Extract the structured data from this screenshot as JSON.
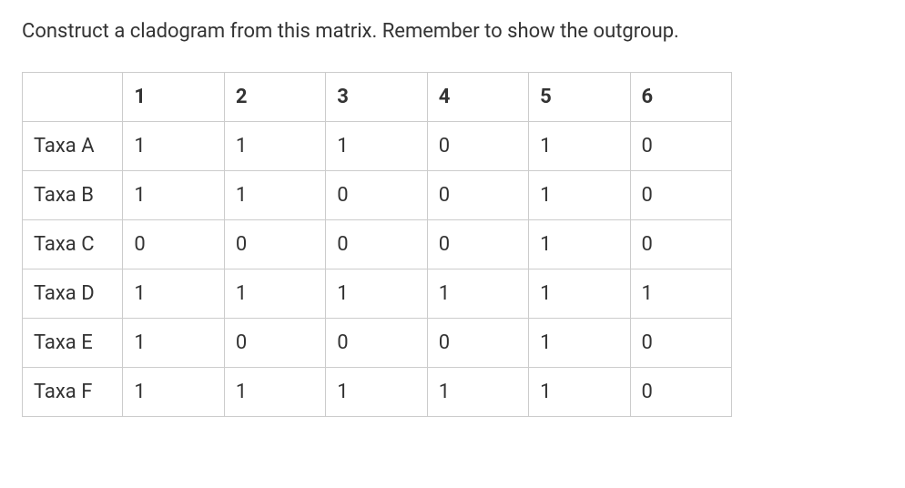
{
  "instruction": "Construct a cladogram from this matrix. Remember to show the outgroup.",
  "table": {
    "headers": [
      "",
      "1",
      "2",
      "3",
      "4",
      "5",
      "6"
    ],
    "rows": [
      {
        "label": "Taxa A",
        "values": [
          "1",
          "1",
          "1",
          "0",
          "1",
          "0"
        ]
      },
      {
        "label": "Taxa B",
        "values": [
          "1",
          "1",
          "0",
          "0",
          "1",
          "0"
        ]
      },
      {
        "label": "Taxa C",
        "values": [
          "0",
          "0",
          "0",
          "0",
          "1",
          "0"
        ]
      },
      {
        "label": "Taxa D",
        "values": [
          "1",
          "1",
          "1",
          "1",
          "1",
          "1"
        ]
      },
      {
        "label": "Taxa E",
        "values": [
          "1",
          "0",
          "0",
          "0",
          "1",
          "0"
        ]
      },
      {
        "label": "Taxa F",
        "values": [
          "1",
          "1",
          "1",
          "1",
          "1",
          "0"
        ]
      }
    ]
  }
}
